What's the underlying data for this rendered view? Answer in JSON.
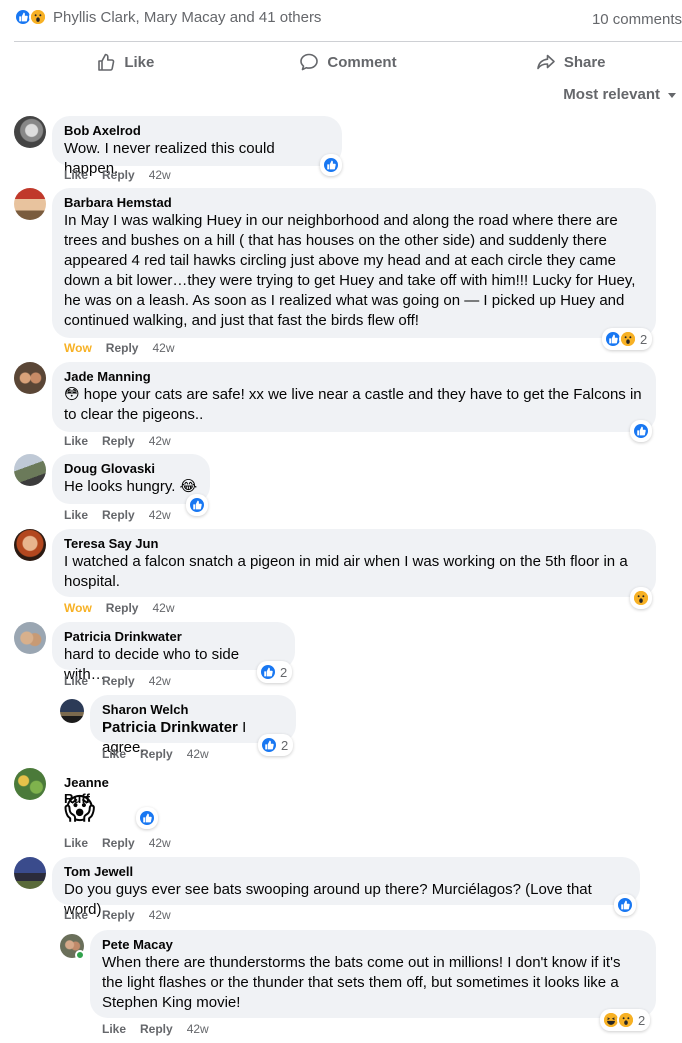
{
  "post_summary": {
    "reaction_icons": [
      "like-icon",
      "wow-icon"
    ],
    "names": "Phyllis Clark, Mary Macay and 41 others",
    "comments_count": "10 comments"
  },
  "actions": {
    "like": "Like",
    "comment": "Comment",
    "share": "Share"
  },
  "sort": {
    "label": "Most relevant"
  },
  "colors": {
    "like_blue": "#1877f2",
    "wow_yellow": "#f7b125",
    "bubble_bg": "#f0f2f5",
    "meta_gray": "#65676b"
  },
  "comments": [
    {
      "author": "Bob Axelrod",
      "text": "Wow. I never realized this could happen.",
      "reaction_label": "Like",
      "reply": "Reply",
      "time": "42w",
      "reactions": [
        "like-icon"
      ],
      "reaction_count": ""
    },
    {
      "author": "Barbara Hemstad",
      "text": "In May I was walking Huey in our neighborhood and along the road where there are trees and bushes on a hill ( that has houses on the other side) and suddenly there appeared 4 red tail hawks circling just above my head and at each circle they came down a bit lower…they were trying to get Huey and take off with him!!! Lucky for Huey, he was on a leash. As soon as I realized what was going on — I picked up Huey and continued walking, and just that fast the birds flew off!",
      "reaction_label": "Wow",
      "reply": "Reply",
      "time": "42w",
      "reactions": [
        "like-icon",
        "wow-icon"
      ],
      "reaction_count": "2"
    },
    {
      "author": "Jade Manning",
      "text": "😳 hope your cats are safe! xx we live near a castle and they have to get the Falcons in to clear the pigeons..",
      "reaction_label": "Like",
      "reply": "Reply",
      "time": "42w",
      "reactions": [
        "like-icon"
      ],
      "reaction_count": ""
    },
    {
      "author": "Doug Glovaski",
      "text": "He looks hungry. 😂",
      "reaction_label": "Like",
      "reply": "Reply",
      "time": "42w",
      "reactions": [
        "like-icon"
      ],
      "reaction_count": ""
    },
    {
      "author": "Teresa Say Jun",
      "text": "I watched a falcon snatch a pigeon in mid air when I was working on the 5th floor in a hospital.",
      "reaction_label": "Wow",
      "reply": "Reply",
      "time": "42w",
      "reactions": [
        "wow-icon"
      ],
      "reaction_count": ""
    },
    {
      "author": "Patricia Drinkwater",
      "text": "hard to decide who to side with…",
      "reaction_label": "Like",
      "reply": "Reply",
      "time": "42w",
      "reactions": [
        "like-icon"
      ],
      "reaction_count": "2"
    },
    {
      "author": "Sharon Welch",
      "mention": "Patricia Drinkwater",
      "text": " I agree.",
      "reaction_label": "Like",
      "reply": "Reply",
      "time": "42w",
      "reactions": [
        "like-icon"
      ],
      "reaction_count": "2"
    },
    {
      "author": "Jeanne Ruff",
      "text": "😱",
      "reaction_label": "Like",
      "reply": "Reply",
      "time": "42w",
      "reactions": [
        "like-icon"
      ],
      "reaction_count": ""
    },
    {
      "author": "Tom Jewell",
      "text": "Do you guys ever see bats swooping around up there? Murciélagos? (Love that word)",
      "reaction_label": "Like",
      "reply": "Reply",
      "time": "42w",
      "reactions": [
        "like-icon"
      ],
      "reaction_count": ""
    },
    {
      "author": "Pete Macay",
      "text": "When there are thunderstorms the bats come out in millions! I don't know if it's the light flashes or the thunder that sets them off, but sometimes it looks like a Stephen King movie!",
      "reaction_label": "Like",
      "reply": "Reply",
      "time": "42w",
      "reactions": [
        "haha-icon",
        "wow-icon"
      ],
      "reaction_count": "2"
    }
  ]
}
